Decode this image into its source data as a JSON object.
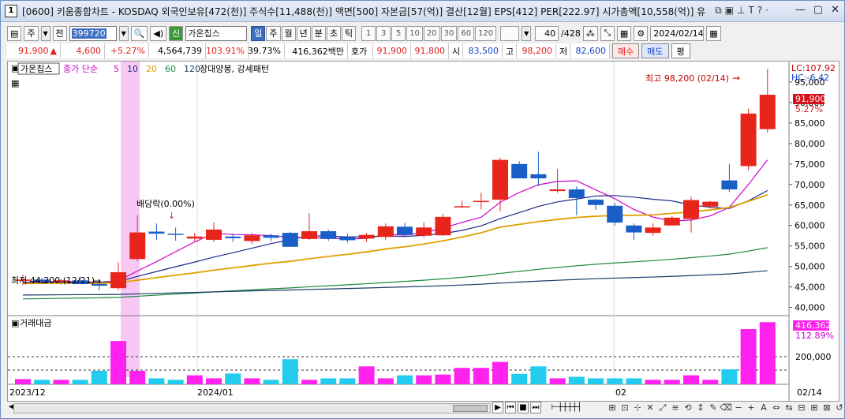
{
  "title": {
    "window_number": "1",
    "text": "[0600] 키움종합차트 - KOSDAQ 외국인보유[472(천)] 주식수[11,488(천)] 액면[500] 자본금[57(억)] 결산[12월] EPS[412] PER[222.97] 시가총액[10,558(억)] 유"
  },
  "toolbar": {
    "period_label": "주",
    "full_label": "전",
    "code": "399720",
    "name_prefix": "신",
    "name": "가온칩스",
    "interval_buttons": [
      "일",
      "주",
      "월",
      "년",
      "분",
      "초",
      "틱"
    ],
    "selected_interval": "일",
    "number_buttons": [
      "1",
      "3",
      "5",
      "10",
      "20",
      "30",
      "60",
      "120"
    ],
    "count": "40",
    "total": "/428",
    "date": "2024/02/14"
  },
  "quote": {
    "price": "91,900",
    "arrow": "▲",
    "change": "4,600",
    "change_pct": "+5.27%",
    "volume": "4,564,739",
    "vol_ratio": "103.91%",
    "turnover": "39.73%",
    "amount": "416,362백만",
    "hoga_label": "호가",
    "ask": "91,900",
    "bid": "91,800",
    "open_label": "시",
    "open": "83,500",
    "high_label": "고",
    "high": "98,200",
    "low_label": "저",
    "low": "82,600",
    "buy_label": "매수",
    "sell_label": "매도",
    "avg_label": "평"
  },
  "chart": {
    "legend_name": "가온칩스",
    "ma_label": "종가 단순",
    "ma_periods": [
      "5",
      "10",
      "20",
      "60",
      "120"
    ],
    "ma_colors": [
      "#cc00cc",
      "#1a2a8a",
      "#e0a000",
      "#1a8a3a",
      "#1a3a6a"
    ],
    "pattern_label": "장대양봉, 강세패턴",
    "dividend_label": "배당락(0.00%)",
    "max_label": "최고 98,200 (02/14)",
    "min_label": "최저 44,200 (12/21)",
    "lc_label": "LC:107.92",
    "hc_label": "HC:-6.42",
    "current_price_tag": "91,900",
    "current_pct": "5.27%",
    "price_ticks": [
      "95,000",
      "90,000",
      "85,000",
      "80,000",
      "75,000",
      "70,000",
      "65,000",
      "60,000",
      "55,000",
      "50,000",
      "45,000",
      "40,000"
    ],
    "volume_title": "거래대금",
    "volume_tag": "416,362",
    "volume_pct": "112.89%",
    "volume_tick": "200,000",
    "x_labels": [
      "2023/12",
      "2024/01",
      "02"
    ],
    "end_date": "02/14",
    "up_color": "#e8251b",
    "down_color": "#1a5fc8"
  },
  "chart_data": {
    "type": "candlestick",
    "price_unit": "KRW",
    "ylim": [
      38000,
      100000
    ],
    "candles": [
      {
        "o": 46500,
        "h": 48000,
        "l": 45500,
        "c": 46800
      },
      {
        "o": 46800,
        "h": 47300,
        "l": 46000,
        "c": 46300
      },
      {
        "o": 46300,
        "h": 47000,
        "l": 45600,
        "c": 46600
      },
      {
        "o": 46600,
        "h": 47300,
        "l": 45800,
        "c": 45700
      },
      {
        "o": 45700,
        "h": 46500,
        "l": 44200,
        "c": 45300
      },
      {
        "o": 44700,
        "h": 51000,
        "l": 44200,
        "c": 48600
      },
      {
        "o": 51800,
        "h": 62500,
        "l": 51300,
        "c": 58300
      },
      {
        "o": 58500,
        "h": 60500,
        "l": 56500,
        "c": 58000
      },
      {
        "o": 58000,
        "h": 59500,
        "l": 56300,
        "c": 57800
      },
      {
        "o": 56800,
        "h": 58200,
        "l": 56000,
        "c": 57300
      },
      {
        "o": 56500,
        "h": 60800,
        "l": 56000,
        "c": 59000
      },
      {
        "o": 57300,
        "h": 58000,
        "l": 56000,
        "c": 56900
      },
      {
        "o": 56200,
        "h": 58200,
        "l": 55500,
        "c": 57600
      },
      {
        "o": 57600,
        "h": 58000,
        "l": 56200,
        "c": 57000
      },
      {
        "o": 58200,
        "h": 58500,
        "l": 54800,
        "c": 54800
      },
      {
        "o": 56700,
        "h": 63000,
        "l": 56500,
        "c": 58600
      },
      {
        "o": 58600,
        "h": 59000,
        "l": 56200,
        "c": 56700
      },
      {
        "o": 57200,
        "h": 58000,
        "l": 55800,
        "c": 56400
      },
      {
        "o": 56800,
        "h": 58200,
        "l": 56000,
        "c": 57700
      },
      {
        "o": 57200,
        "h": 60500,
        "l": 56500,
        "c": 59800
      },
      {
        "o": 59700,
        "h": 60600,
        "l": 57500,
        "c": 57700
      },
      {
        "o": 57500,
        "h": 60800,
        "l": 57000,
        "c": 59500
      },
      {
        "o": 57600,
        "h": 62800,
        "l": 57500,
        "c": 62100
      },
      {
        "o": 64700,
        "h": 66000,
        "l": 64300,
        "c": 64700
      },
      {
        "o": 66000,
        "h": 68000,
        "l": 63900,
        "c": 66000
      },
      {
        "o": 66300,
        "h": 76500,
        "l": 63500,
        "c": 76000
      },
      {
        "o": 75000,
        "h": 75700,
        "l": 71500,
        "c": 71500
      },
      {
        "o": 72500,
        "h": 78000,
        "l": 69600,
        "c": 71500
      },
      {
        "o": 68400,
        "h": 73800,
        "l": 68000,
        "c": 68800
      },
      {
        "o": 68800,
        "h": 69500,
        "l": 62500,
        "c": 66700
      },
      {
        "o": 66300,
        "h": 66500,
        "l": 63800,
        "c": 65000
      },
      {
        "o": 64800,
        "h": 65500,
        "l": 60000,
        "c": 60700
      },
      {
        "o": 60000,
        "h": 60500,
        "l": 56500,
        "c": 58300
      },
      {
        "o": 58200,
        "h": 60500,
        "l": 57500,
        "c": 59500
      },
      {
        "o": 60000,
        "h": 62300,
        "l": 60000,
        "c": 61900
      },
      {
        "o": 61600,
        "h": 67000,
        "l": 58300,
        "c": 66200
      },
      {
        "o": 64600,
        "h": 66000,
        "l": 64200,
        "c": 65800
      },
      {
        "o": 71000,
        "h": 75000,
        "l": 68200,
        "c": 68800
      },
      {
        "o": 74500,
        "h": 88500,
        "l": 73500,
        "c": 87300
      },
      {
        "o": 83500,
        "h": 98200,
        "l": 82600,
        "c": 91900
      }
    ],
    "volume_amount": [
      35000,
      30000,
      30000,
      30000,
      90000,
      290000,
      90000,
      40000,
      30000,
      60000,
      40000,
      72000,
      40000,
      30000,
      168000,
      30000,
      40000,
      40000,
      120000,
      40000,
      60000,
      60000,
      65000,
      110000,
      110000,
      150000,
      70000,
      120000,
      40000,
      50000,
      40000,
      40000,
      40000,
      30000,
      30000,
      60000,
      30000,
      100000,
      370000,
      416362
    ],
    "volume_ylim": [
      0,
      460000
    ]
  }
}
